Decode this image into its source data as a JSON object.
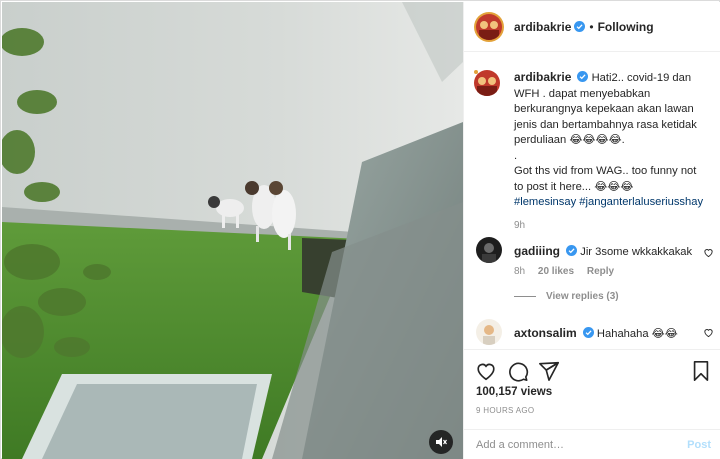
{
  "header": {
    "username": "ardibakrie",
    "separator": "•",
    "follow_label": "Following"
  },
  "caption": {
    "username": "ardibakrie",
    "lines": [
      "Hati2.. covid-19 dan",
      "WFH . dapat menyebabkan",
      "berkurangnya kepekaan akan lawan",
      "jenis dan bertambahnya rasa ketidak",
      "perduliaan 😂😂😂😂.",
      ".",
      "Got ths vid from WAG.. too funny not",
      "to post it here... 😂😂😂"
    ],
    "hashtags": "#lemesinsay #janganterlaluseriusshay",
    "time": "9h"
  },
  "comments": [
    {
      "username": "gadiiing",
      "text": "Jir 3some wkkakkakak",
      "time": "8h",
      "likes": "20 likes",
      "reply_label": "Reply",
      "view_replies": "View replies (3)"
    },
    {
      "username": "axtonsalim",
      "text": "Hahahaha 😂😂"
    }
  ],
  "actions": {
    "views": "100,157 views",
    "ago": "9 HOURS AGO"
  },
  "add_comment": {
    "placeholder": "Add a comment…",
    "post_label": "Post"
  },
  "icons": {
    "like": "heart-icon",
    "comment": "comment-icon",
    "share": "share-icon",
    "save": "bookmark-icon",
    "mute": "speaker-icon",
    "verified": "verified-badge-icon"
  },
  "colors": {
    "link": "#00376b",
    "verified": "#3897f0",
    "post_disabled": "#b2dffc",
    "muted_text": "#8e8e8e"
  }
}
